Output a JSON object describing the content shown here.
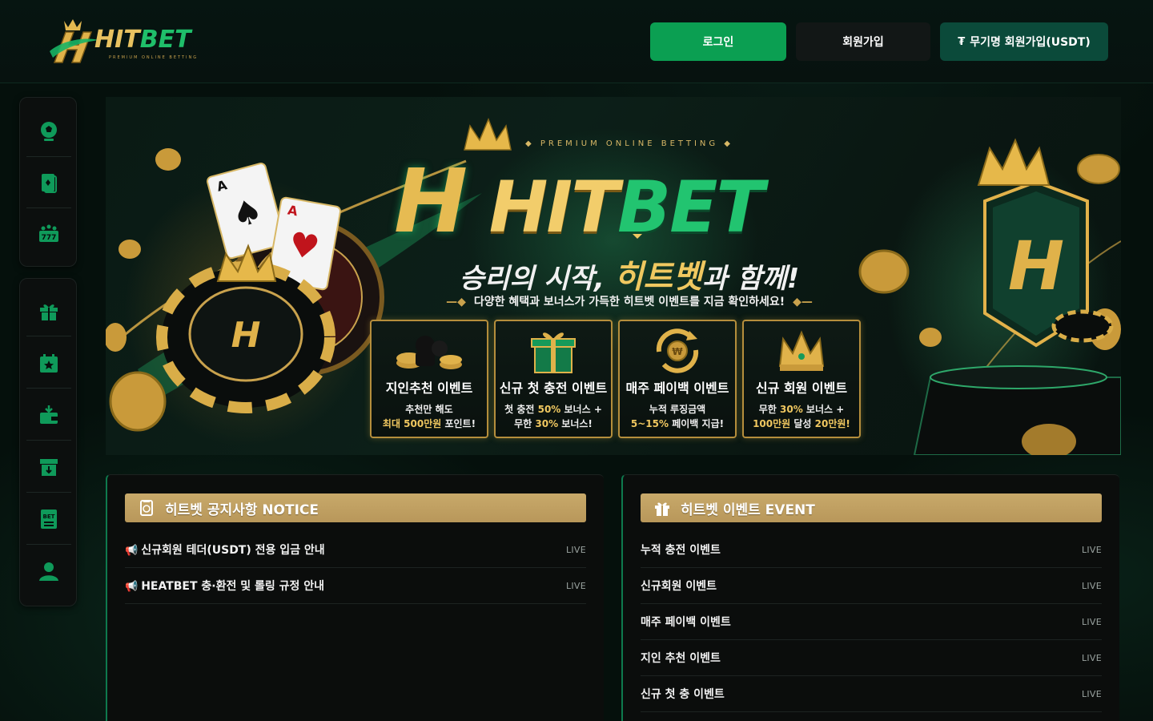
{
  "header": {
    "logo_hit": "HIT",
    "logo_bet": "BET",
    "logo_sub": "PREMIUM ONLINE BETTING",
    "login_label": "로그인",
    "join_label": "회원가입",
    "anon_join_label": "무기명 회원가입(USDT)",
    "anon_join_glyph": "₮"
  },
  "sidebar": {
    "group1": [
      {
        "icon": "soccer-ball-icon"
      },
      {
        "icon": "playing-card-icon"
      },
      {
        "icon": "slot-777-icon"
      }
    ],
    "group2": [
      {
        "icon": "gift-icon"
      },
      {
        "icon": "calendar-star-icon"
      },
      {
        "icon": "wallet-deposit-icon"
      },
      {
        "icon": "withdraw-box-icon"
      },
      {
        "icon": "bet-slip-icon"
      },
      {
        "icon": "user-icon"
      }
    ]
  },
  "banner": {
    "premium": "◆ PREMIUM ONLINE BETTING ◆",
    "logo_hit": "HIT",
    "logo_bet": "BET",
    "slogan_a": "승리의 시작, ",
    "slogan_b": "히트벳",
    "slogan_c": "과 함께!",
    "sub": "다양한 혜택과 보너스가 가득한 히트벳 이벤트를 지금 확인하세요!",
    "cards": [
      {
        "title": "지인추천 이벤트",
        "d1": "추천만 해도",
        "d2a": "최대 500만원",
        "d2b": " 포인트!",
        "art": "chips-coins"
      },
      {
        "title": "신규 첫 충전 이벤트",
        "d1a": "첫 충전 ",
        "d1b": "50%",
        "d1c": " 보너스 +",
        "d2a": "무한 ",
        "d2b": "30%",
        "d2c": " 보너스!",
        "art": "gift-box"
      },
      {
        "title": "매주 페이백 이벤트",
        "d1": "누적 루징금액",
        "d2a": "5~15%",
        "d2b": " 페이백 지급!",
        "art": "coin-cycle"
      },
      {
        "title": "신규 회원 이벤트",
        "d1a": "무한 ",
        "d1b": "30%",
        "d1c": " 보너스 +",
        "d2a": "100만원",
        "d2b": " 달성 ",
        "d2c": "20만원!",
        "art": "crown"
      }
    ]
  },
  "notice": {
    "title": "히트벳 공지사항 NOTICE",
    "items": [
      {
        "text": "신규회원 테더(USDT) 전용 입금 안내",
        "badge": "LIVE",
        "glyph": "📢"
      },
      {
        "text": "HEATBET 충·환전 및 롤링 규정 안내",
        "badge": "LIVE",
        "glyph": "📢"
      }
    ]
  },
  "event": {
    "title": "히트벳 이벤트 EVENT",
    "items": [
      {
        "text": "누적 충전 이벤트",
        "badge": "LIVE"
      },
      {
        "text": "신규회원 이벤트",
        "badge": "LIVE"
      },
      {
        "text": "매주 페이백 이벤트",
        "badge": "LIVE"
      },
      {
        "text": "지인 추천 이벤트",
        "badge": "LIVE"
      },
      {
        "text": "신규 첫 충 이벤트",
        "badge": "LIVE"
      }
    ]
  },
  "colors": {
    "accent_green": "#0b9f52",
    "gold": "#c8a96a",
    "background": "#06100d"
  }
}
